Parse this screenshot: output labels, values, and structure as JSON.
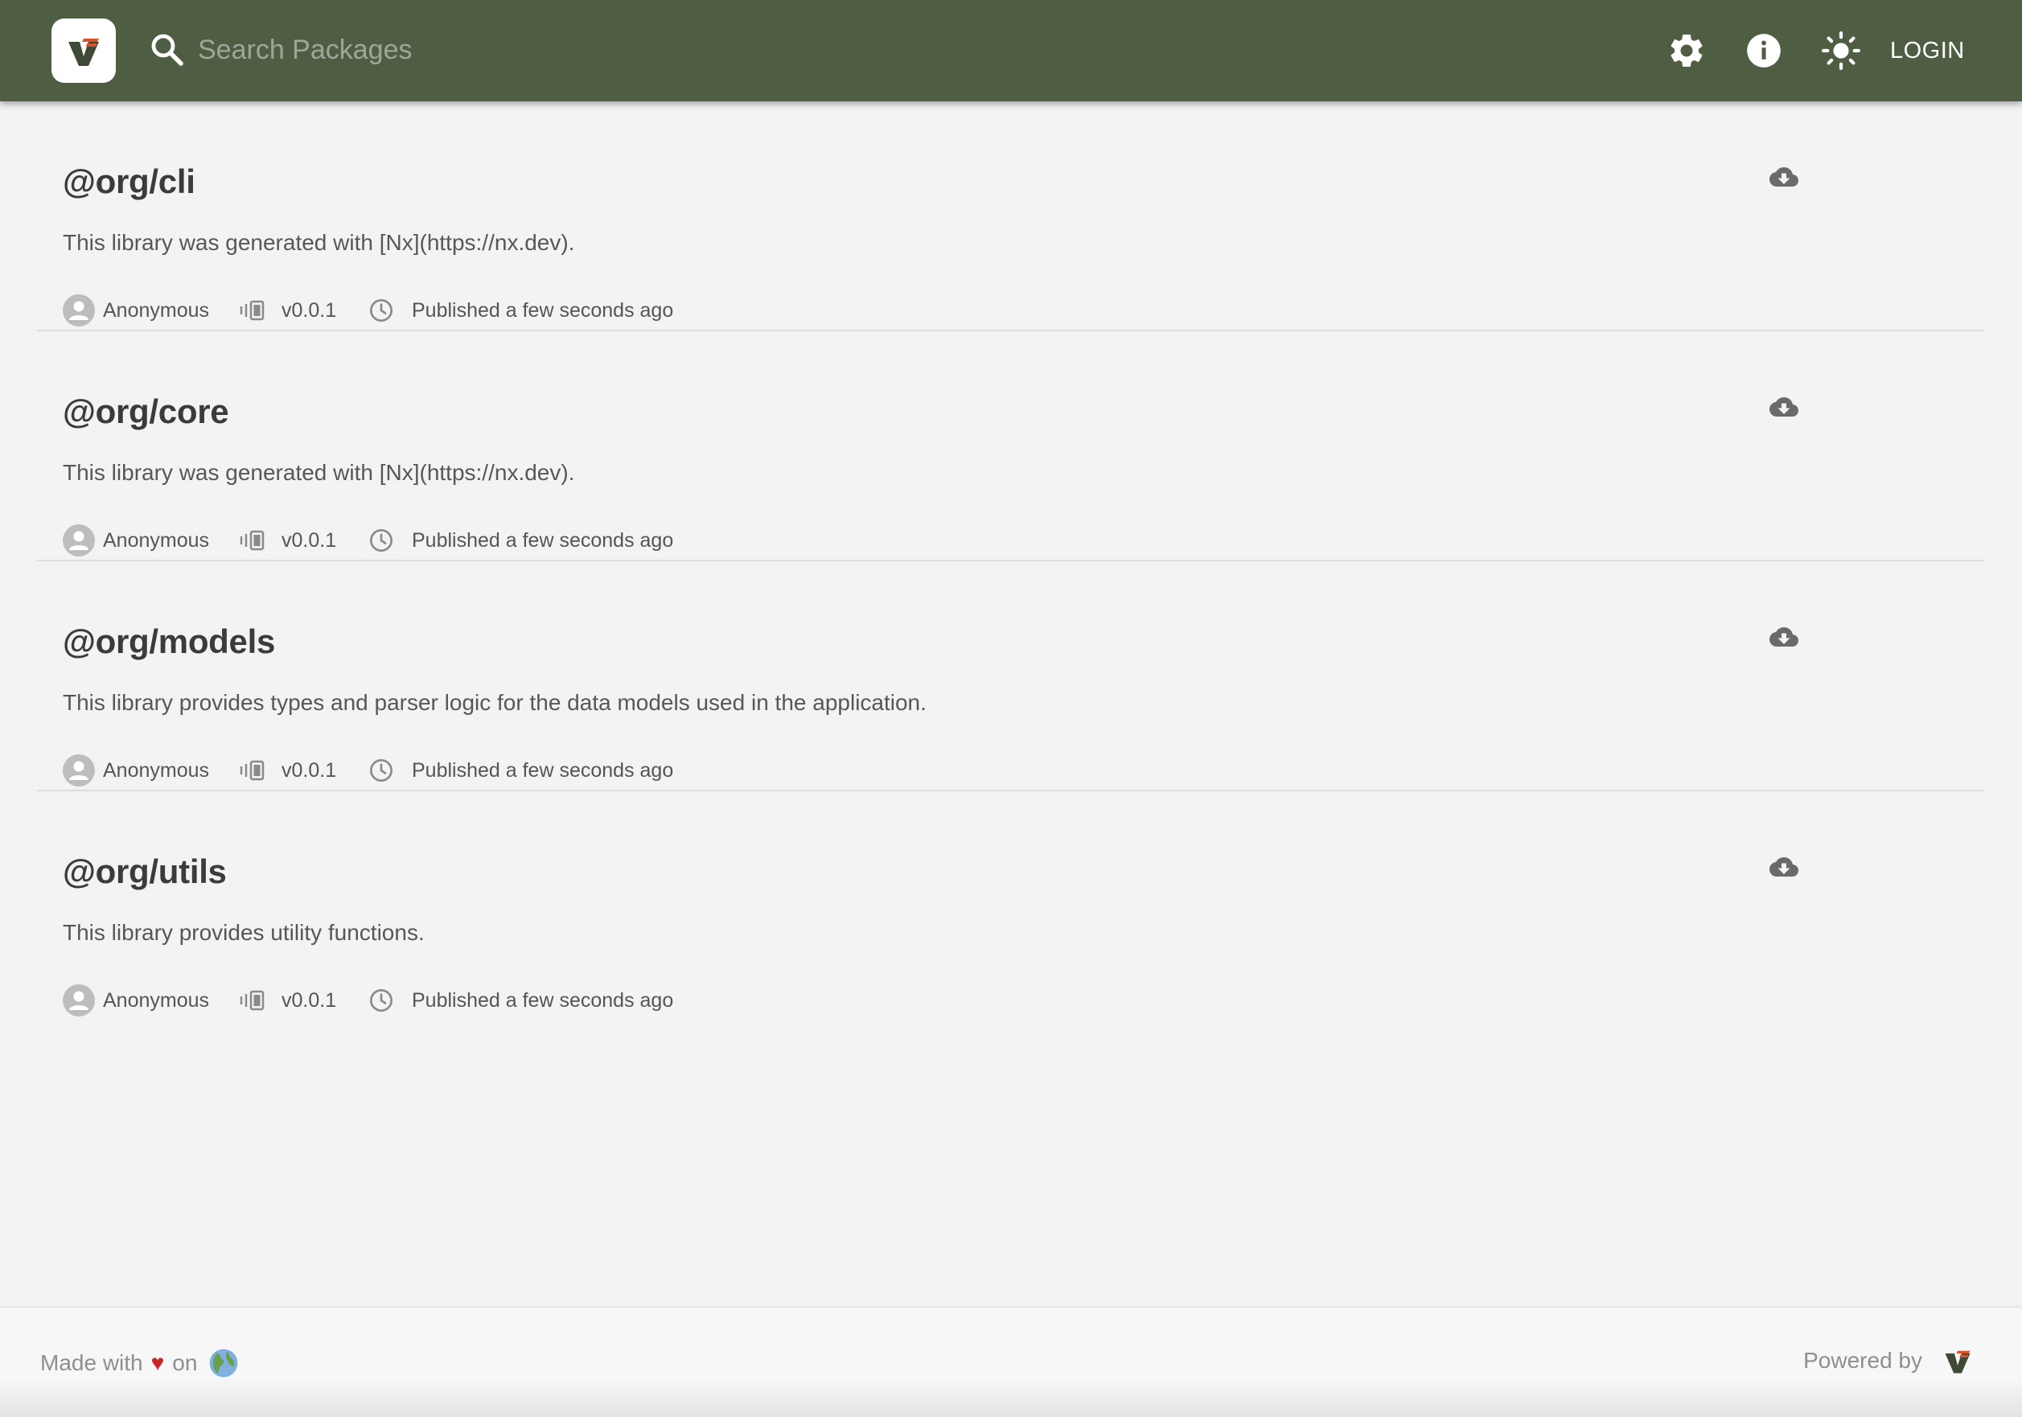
{
  "header": {
    "search_placeholder": "Search Packages",
    "login_label": "LOGIN",
    "icons": [
      "settings-icon",
      "info-icon",
      "theme-toggle-icon"
    ]
  },
  "packages": [
    {
      "name": "@org/cli",
      "description": "This library was generated with [Nx](https://nx.dev).",
      "author": "Anonymous",
      "version": "v0.0.1",
      "published": "Published a few seconds ago"
    },
    {
      "name": "@org/core",
      "description": "This library was generated with [Nx](https://nx.dev).",
      "author": "Anonymous",
      "version": "v0.0.1",
      "published": "Published a few seconds ago"
    },
    {
      "name": "@org/models",
      "description": "This library provides types and parser logic for the data models used in the application.",
      "author": "Anonymous",
      "version": "v0.0.1",
      "published": "Published a few seconds ago"
    },
    {
      "name": "@org/utils",
      "description": "This library provides utility functions.",
      "author": "Anonymous",
      "version": "v0.0.1",
      "published": "Published a few seconds ago"
    }
  ],
  "footer": {
    "made_with": "Made with",
    "heart": "♥",
    "on": "on",
    "powered_by": "Powered by"
  },
  "colors": {
    "header_bg": "#4f5e43",
    "page_bg": "#f3f3f3",
    "logo_accent": "#d9532b",
    "logo_dark": "#3f4a36",
    "heart": "#c62828"
  }
}
